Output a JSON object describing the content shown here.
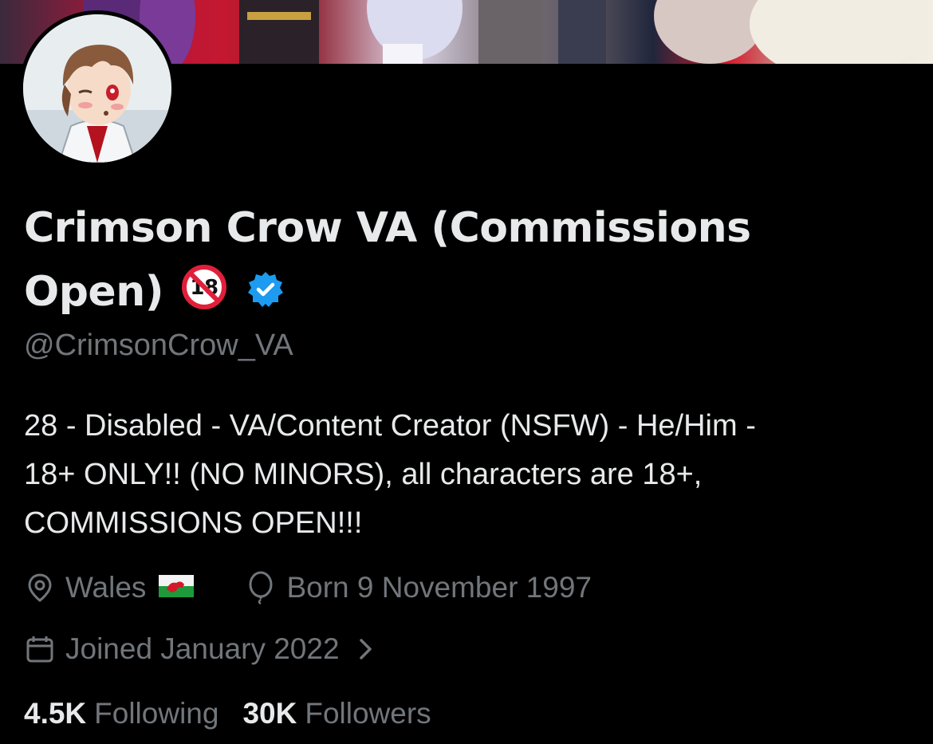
{
  "profile": {
    "display_name_line1": "Crimson Crow VA (Commissions",
    "display_name_line2": "Open)",
    "badge_18": "18",
    "handle": "@CrimsonCrow_VA",
    "bio_lines": [
      "28 - Disabled - VA/Content Creator (NSFW) - He/Him -",
      "18+ ONLY!! (NO MINORS), all characters are 18+,",
      "COMMISSIONS OPEN!!!"
    ],
    "location": "Wales",
    "birthday": "Born 9 November 1997",
    "joined": "Joined January 2022",
    "following_count": "4.5K",
    "following_label": "Following",
    "followers_count": "30K",
    "followers_label": "Followers"
  },
  "icons": {
    "location": "location-pin-icon",
    "birthday": "balloon-icon",
    "joined": "calendar-icon",
    "verified": "verified-badge-icon",
    "age": "no-under-18-icon",
    "flag": "wales-flag-icon",
    "chevron": "chevron-right-icon"
  },
  "colors": {
    "background": "#000000",
    "primary_text": "#e7e9ea",
    "secondary_text": "#71767b",
    "verified_blue": "#1d9bf0",
    "prohibit_red": "#e0203a"
  }
}
